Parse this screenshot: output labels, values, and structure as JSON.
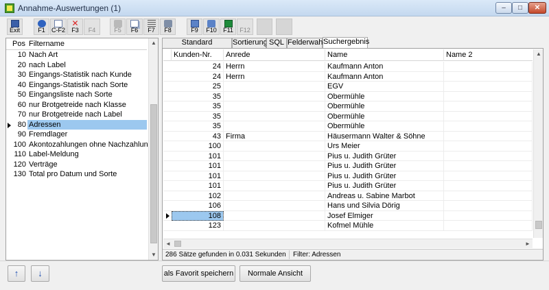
{
  "window": {
    "title": "Annahme-Auswertungen (1)",
    "min_glyph": "–",
    "max_glyph": "□",
    "close_glyph": "✕"
  },
  "toolbar": {
    "buttons": [
      {
        "label": "Exit",
        "icon": "exit-door-icon"
      },
      {
        "label": "F1",
        "icon": "help-icon"
      },
      {
        "label": "C-F2",
        "icon": "new-document-icon"
      },
      {
        "label": "F3",
        "icon": "delete-x-icon"
      },
      {
        "label": "F4",
        "icon": "",
        "disabled": true
      },
      {
        "label": "F5",
        "icon": "tools-icon",
        "disabled": true
      },
      {
        "label": "F6",
        "icon": "copy-icon"
      },
      {
        "label": "F7",
        "icon": "list-icon"
      },
      {
        "label": "F8",
        "icon": "print-icon"
      },
      {
        "label": "F9",
        "icon": "search-icon"
      },
      {
        "label": "F10",
        "icon": "printer-icon"
      },
      {
        "label": "F11",
        "icon": "excel-icon"
      },
      {
        "label": "F12",
        "icon": "",
        "disabled": true
      }
    ]
  },
  "filters": {
    "col_pos": "Pos",
    "col_name": "Filtername",
    "items": [
      {
        "pos": "10",
        "name": "Nach Art"
      },
      {
        "pos": "20",
        "name": "nach Label"
      },
      {
        "pos": "30",
        "name": "Eingangs-Statistik nach Kunde"
      },
      {
        "pos": "40",
        "name": "Eingangs-Statistik nach Sorte"
      },
      {
        "pos": "50",
        "name": "Eingangsliste nach Sorte"
      },
      {
        "pos": "60",
        "name": "nur Brotgetreide nach Klasse"
      },
      {
        "pos": "70",
        "name": "nur Brotgetreide nach Label"
      },
      {
        "pos": "80",
        "name": "Adressen"
      },
      {
        "pos": "90",
        "name": "Fremdlager"
      },
      {
        "pos": "100",
        "name": "Akontozahlungen ohne Nachzahlung"
      },
      {
        "pos": "110",
        "name": "Label-Meldung"
      },
      {
        "pos": "120",
        "name": "Verträge"
      },
      {
        "pos": "130",
        "name": "Total pro Datum und Sorte"
      }
    ]
  },
  "tabs": [
    "Standard Einstellungen",
    "Sortierung",
    "SQL",
    "Felderwahl",
    "Suchergebnis"
  ],
  "grid": {
    "columns": [
      "Kunden-Nr.",
      "Anrede",
      "Name",
      "Name 2"
    ],
    "rows": [
      [
        "24",
        "Herrn",
        "Kaufmann Anton",
        ""
      ],
      [
        "24",
        "Herrn",
        "Kaufmann Anton",
        ""
      ],
      [
        "25",
        "",
        "EGV",
        ""
      ],
      [
        "35",
        "",
        "Obermühle",
        ""
      ],
      [
        "35",
        "",
        "Obermühle",
        ""
      ],
      [
        "35",
        "",
        "Obermühle",
        ""
      ],
      [
        "35",
        "",
        "Obermühle",
        ""
      ],
      [
        "43",
        "Firma",
        "Häusermann Walter & Söhne",
        ""
      ],
      [
        "100",
        "",
        "Urs Meier",
        ""
      ],
      [
        "101",
        "",
        "Pius u. Judith Grüter",
        ""
      ],
      [
        "101",
        "",
        "Pius u. Judith Grüter",
        ""
      ],
      [
        "101",
        "",
        "Pius u. Judith Grüter",
        ""
      ],
      [
        "101",
        "",
        "Pius u. Judith Grüter",
        ""
      ],
      [
        "102",
        "",
        "Andreas u. Sabine Marbot",
        ""
      ],
      [
        "106",
        "",
        "Hans und Silvia Dörig",
        ""
      ],
      [
        "108",
        "",
        "Josef Elmiger",
        ""
      ],
      [
        "123",
        "",
        "Kofmel Mühle",
        ""
      ]
    ]
  },
  "status": {
    "found": "286 Sätze gefunden in 0.031 Sekunden",
    "filter": "Filter: Adressen"
  },
  "bottom": {
    "up": "↑",
    "down": "↓",
    "save_favorite": "als Favorit speichern",
    "normal_view": "Normale Ansicht"
  },
  "colors": {
    "selection": "#9cc8ef",
    "title_bar": "#c4d8ef"
  }
}
